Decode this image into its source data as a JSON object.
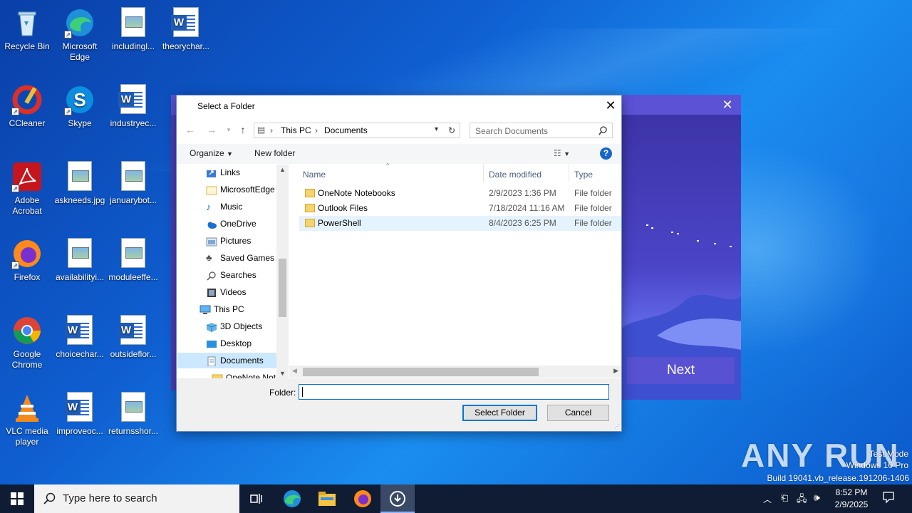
{
  "desktop": {
    "icons": [
      {
        "label": "Recycle Bin"
      },
      {
        "label": "Microsoft Edge"
      },
      {
        "label": "includingl..."
      },
      {
        "label": "theorychar..."
      },
      {
        "label": "CCleaner"
      },
      {
        "label": "Skype"
      },
      {
        "label": "industryec..."
      },
      {
        "label": "Adobe Acrobat"
      },
      {
        "label": "askneeds.jpg"
      },
      {
        "label": "januarybot..."
      },
      {
        "label": "Firefox"
      },
      {
        "label": "availabilityi..."
      },
      {
        "label": "moduleeffe..."
      },
      {
        "label": "Google Chrome"
      },
      {
        "label": "choicechar..."
      },
      {
        "label": "outsideflor..."
      },
      {
        "label": "VLC media player"
      },
      {
        "label": "improveoc..."
      },
      {
        "label": "returnsshor..."
      }
    ]
  },
  "bg_app": {
    "next_label": "Next",
    "close_glyph": "✕"
  },
  "dialog": {
    "title": "Select a Folder",
    "close_glyph": "✕",
    "breadcrumb": [
      "This PC",
      "Documents"
    ],
    "search_placeholder": "Search Documents",
    "toolbar": {
      "organize": "Organize",
      "new_folder": "New folder",
      "help": "?"
    },
    "tree": [
      {
        "label": "Links"
      },
      {
        "label": "MicrosoftEdge"
      },
      {
        "label": "Music"
      },
      {
        "label": "OneDrive"
      },
      {
        "label": "Pictures"
      },
      {
        "label": "Saved Games"
      },
      {
        "label": "Searches"
      },
      {
        "label": "Videos"
      },
      {
        "label": "This PC"
      },
      {
        "label": "3D Objects"
      },
      {
        "label": "Desktop"
      },
      {
        "label": "Documents"
      },
      {
        "label": "OneNote Not"
      }
    ],
    "columns": {
      "name": "Name",
      "date": "Date modified",
      "type": "Type"
    },
    "rows": [
      {
        "name": "OneNote Notebooks",
        "date": "2/9/2023 1:36 PM",
        "type": "File folder"
      },
      {
        "name": "Outlook Files",
        "date": "7/18/2024 11:16 AM",
        "type": "File folder"
      },
      {
        "name": "PowerShell",
        "date": "8/4/2023 6:25 PM",
        "type": "File folder"
      }
    ],
    "folder_label": "Folder:",
    "folder_value": "",
    "select_button": "Select Folder",
    "cancel_button": "Cancel"
  },
  "taskbar": {
    "search_placeholder": "Type here to search",
    "time": "8:52 PM",
    "date": "2/9/2025"
  },
  "watermark": {
    "brand": "ANY RUN",
    "line1": "Test Mode",
    "line2": "Windows 10 Pro",
    "line3": "Build 19041.vb_release.191206-1406"
  }
}
